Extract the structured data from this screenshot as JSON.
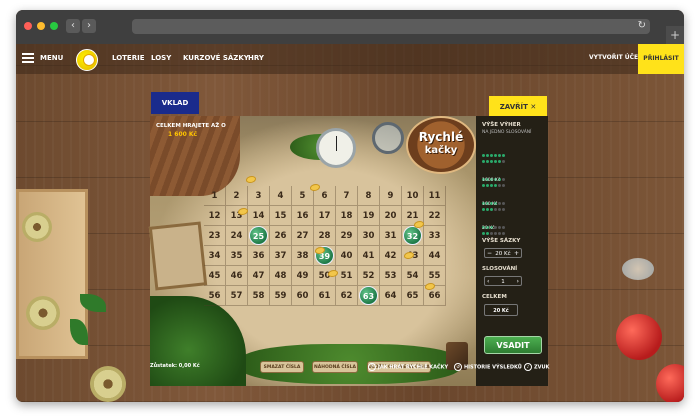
{
  "nav": {
    "menu": "MENU",
    "items": [
      "LOTERIE",
      "LOSY",
      "KURZOVÉ SÁZKY",
      "HRY"
    ],
    "create_account": "VYTVOŘIT ÚČET",
    "login": "PŘIHLÁSIT"
  },
  "game": {
    "deposit": "VKLAD",
    "close": "ZAVŘÍT",
    "close_icon": "close-icon",
    "jackpot_label": "CELKEM HRAJETE AŽ O",
    "jackpot_value": "1 600 Kč",
    "logo_line1": "Rychlé",
    "logo_line2": "kačky",
    "numbers": [
      [
        1,
        2,
        3,
        4,
        5,
        6,
        7,
        8,
        9,
        10,
        11
      ],
      [
        12,
        13,
        14,
        15,
        16,
        17,
        18,
        19,
        20,
        21,
        22
      ],
      [
        23,
        24,
        25,
        26,
        27,
        28,
        29,
        30,
        31,
        32,
        33
      ],
      [
        34,
        35,
        36,
        37,
        38,
        39,
        40,
        41,
        42,
        43,
        44
      ],
      [
        45,
        46,
        47,
        48,
        49,
        50,
        51,
        52,
        53,
        54,
        55
      ],
      [
        56,
        57,
        58,
        59,
        60,
        61,
        62,
        63,
        64,
        65,
        66
      ]
    ],
    "drawn": [
      25,
      32,
      39,
      63
    ],
    "buttons": [
      "SMAZAT ČÍSLA",
      "NÁHODNÁ ČÍSLA",
      "ULOŽIT OBLÍBENÁ ČÍSLA"
    ],
    "balance": "Zůstatek: 0,00 Kč",
    "links": [
      "JAK HRÁT RYCHLÉ KAČKY",
      "HISTORIE VÝSLEDKŮ",
      "ZVUK"
    ]
  },
  "panel": {
    "wins_title": "VÝŠE VÝHER",
    "wins_sub": "NA JEDNO SLOSOVÁNÍ",
    "win_rows": [
      {
        "hits": 5,
        "label": ""
      },
      {
        "hits": 4,
        "label": "1600 Kč"
      },
      {
        "hits": 3,
        "label": "160 Kč"
      },
      {
        "hits": 2,
        "label": "20 Kč"
      }
    ],
    "bet_title": "VÝŠE SÁZKY",
    "bet_value": "20 Kč",
    "draws_title": "SLOSOVÁNÍ",
    "draws_value": "1",
    "total_title": "CELKEM",
    "total_value": "20 Kč",
    "submit": "VSADIT"
  }
}
